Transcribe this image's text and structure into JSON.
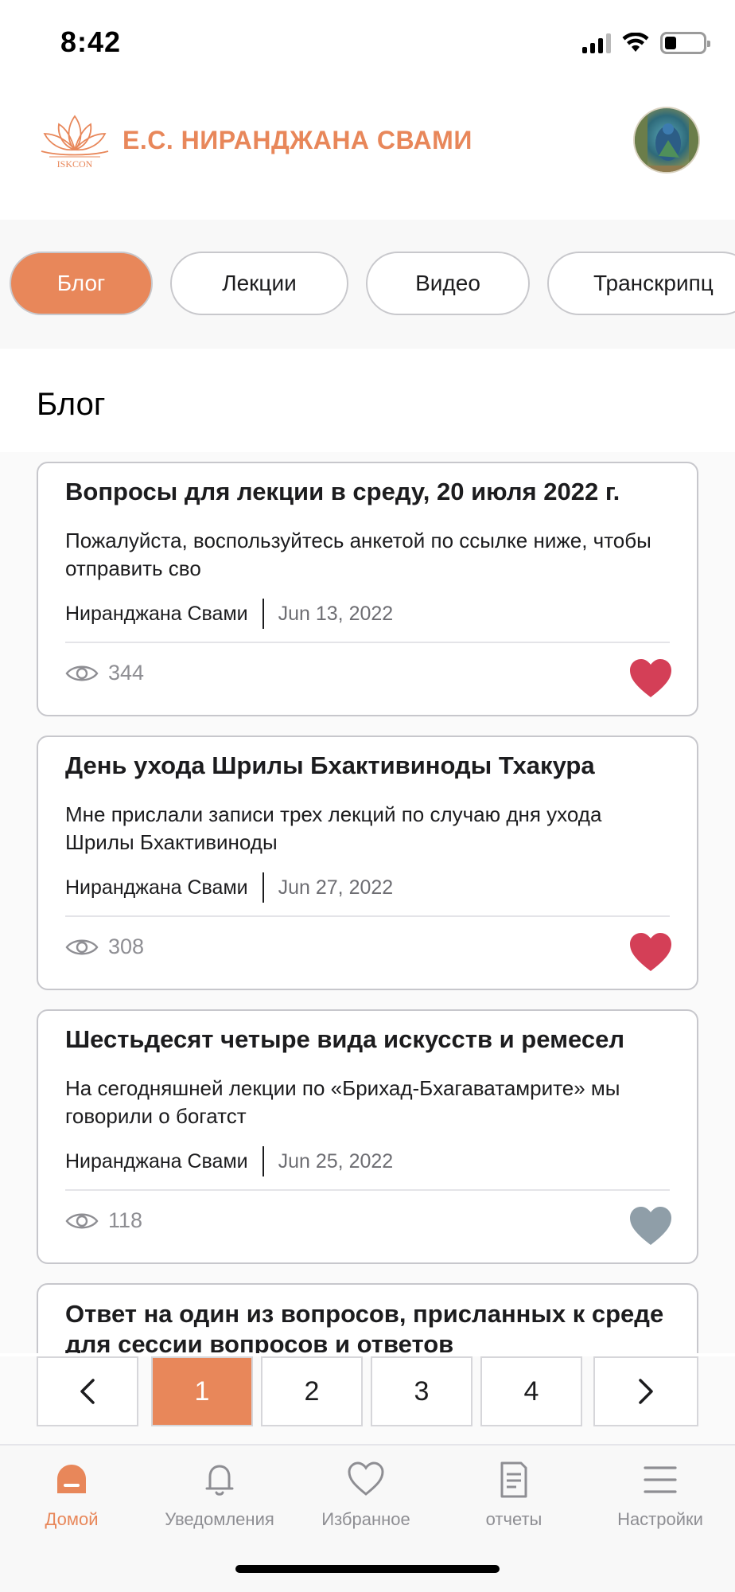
{
  "status_bar": {
    "time": "8:42"
  },
  "header": {
    "title": "Е.С. НИРАНДЖАНА СВАМИ",
    "logo_text": "ISKCON"
  },
  "tabs": [
    {
      "label": "Блог",
      "active": true
    },
    {
      "label": "Лекции",
      "active": false
    },
    {
      "label": "Видео",
      "active": false
    },
    {
      "label": "Транскрипц",
      "active": false
    }
  ],
  "section_title": "Блог",
  "posts": [
    {
      "title": "Вопросы для лекции в среду, 20 июля 2022 г.",
      "excerpt": "Пожалуйста, воспользуйтесь анкетой по ссылке ниже, чтобы отправить сво",
      "author": "Ниранджана Свами",
      "date": "Jun 13, 2022",
      "views": "344",
      "favorited": true
    },
    {
      "title": "День ухода Шрилы Бхактивиноды Тхакура",
      "excerpt": "Мне прислали записи трех лекций по случаю дня ухода Шрилы Бхактивиноды",
      "author": "Ниранджана Свами",
      "date": "Jun 27, 2022",
      "views": "308",
      "favorited": true
    },
    {
      "title": "Шестьдесят четыре вида искусств и ремесел",
      "excerpt": "На сегодняшней лекции по «Брихад-Бхагаватамрите» мы говорили о богатст",
      "author": "Ниранджана Свами",
      "date": "Jun 25, 2022",
      "views": "118",
      "favorited": false
    },
    {
      "title": "Ответ на один из вопросов, присланных к среде для сессии вопросов и ответов"
    }
  ],
  "pagination": {
    "prev_icon": "chevron-left-icon",
    "pages": [
      "1",
      "2",
      "3",
      "4"
    ],
    "current_page": "1",
    "next_icon": "chevron-right-icon"
  },
  "bottom_nav": [
    {
      "label": "Домой",
      "icon": "home-icon",
      "active": true
    },
    {
      "label": "Уведомления",
      "icon": "bell-icon",
      "active": false
    },
    {
      "label": "Избранное",
      "icon": "heart-outline-icon",
      "active": false
    },
    {
      "label": "отчеты",
      "icon": "document-icon",
      "active": false
    },
    {
      "label": "Настройки",
      "icon": "menu-icon",
      "active": false
    }
  ],
  "colors": {
    "accent": "#e8875a",
    "favorite": "#d43f57",
    "not_favorite": "#8f9ea8",
    "muted": "#8e8e93"
  }
}
